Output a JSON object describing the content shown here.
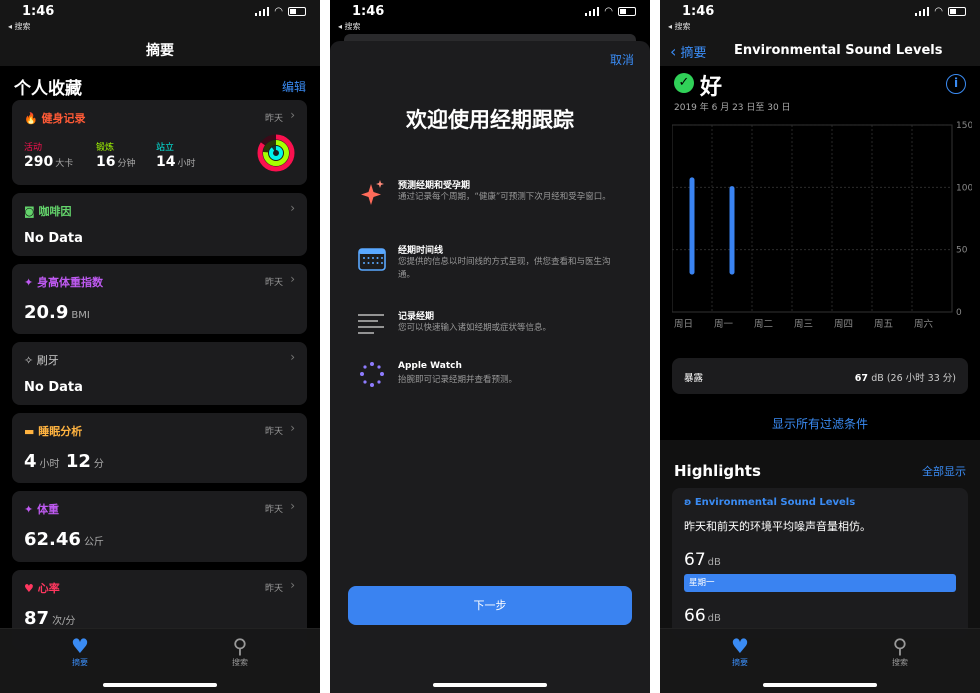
{
  "status": {
    "time": "1:46",
    "back_label": "◂ 搜索"
  },
  "screen1": {
    "nav_title": "摘要",
    "favorites_title": "个人收藏",
    "edit_label": "编辑",
    "fitness": {
      "title": "健身记录",
      "date": "昨天",
      "metrics": [
        {
          "label": "活动",
          "value": "290",
          "unit": "大卡",
          "color": "#fa114f"
        },
        {
          "label": "锻炼",
          "value": "16",
          "unit": "分钟",
          "color": "#a6ff00"
        },
        {
          "label": "站立",
          "value": "14",
          "unit": "小时",
          "color": "#00f5ea"
        }
      ]
    },
    "caffeine": {
      "title": "咖啡因",
      "value": "No Data"
    },
    "bmi": {
      "title": "身高体重指数",
      "date": "昨天",
      "value": "20.9",
      "unit": "BMI"
    },
    "toothbrush": {
      "title": "刷牙",
      "value": "No Data"
    },
    "sleep": {
      "title": "睡眠分析",
      "date": "昨天",
      "hours": "4",
      "hours_unit": "小时",
      "minutes": "12",
      "minutes_unit": "分"
    },
    "weight": {
      "title": "体重",
      "date": "昨天",
      "value": "62.46",
      "unit": "公斤"
    },
    "heart": {
      "title": "心率",
      "date": "昨天",
      "value": "87",
      "unit": "次/分"
    },
    "tabs": {
      "summary": "摘要",
      "search": "搜索"
    },
    "colors": {
      "fitness": "#ff5a36",
      "caffeine": "#63d36b",
      "bmi": "#bf5af2",
      "sleep": "#5ac8fa",
      "heart": "#ff375f"
    }
  },
  "screen2": {
    "cancel_label": "取消",
    "title": "欢迎使用经期跟踪",
    "features": [
      {
        "icon": "sparkle-icon",
        "title": "预测经期和受孕期",
        "desc": "通过记录每个周期，“健康”可预测下次月经和受孕窗口。"
      },
      {
        "icon": "calendar-icon",
        "title": "经期时间线",
        "desc": "您提供的信息以时间线的方式呈现，供您查看和与医生沟通。"
      },
      {
        "icon": "list-icon",
        "title": "记录经期",
        "desc": "您可以快速输入诸如经期或症状等信息。"
      },
      {
        "icon": "watch-dots-icon",
        "title": "Apple Watch",
        "desc": "抬腕即可记录经期并查看预测。"
      }
    ],
    "next_label": "下一步"
  },
  "screen3": {
    "back_label": "摘要",
    "title": "Environmental Sound Levels",
    "status_text": "好",
    "date_range": "2019 年 6 月 23 日至 30 日",
    "exposure_label": "暴露",
    "exposure_value": "67",
    "exposure_unit": "dB (26 小时 33 分)",
    "filters_label": "显示所有过滤条件",
    "highlights_title": "Highlights",
    "highlights_all": "全部显示",
    "hl_card_title": "Environmental Sound Levels",
    "hl_card_desc": "昨天和前天的环境平均噪声音量相仿。",
    "hl_value1": "67",
    "hl_value2": "66",
    "hl_unit": "dB",
    "hl_bar_label": "星期一",
    "tabs": {
      "summary": "摘要",
      "search": "搜索"
    }
  },
  "chart_data": {
    "type": "range-bar",
    "categories": [
      "周日",
      "周一",
      "周二",
      "周三",
      "周四",
      "周五",
      "周六"
    ],
    "ranges": [
      [
        32,
        106
      ],
      [
        32,
        99
      ],
      null,
      null,
      null,
      null,
      null
    ],
    "ylim": [
      0,
      150
    ],
    "yticks": [
      0,
      50,
      100,
      150
    ],
    "color": "#3a83f1",
    "grid": true
  }
}
